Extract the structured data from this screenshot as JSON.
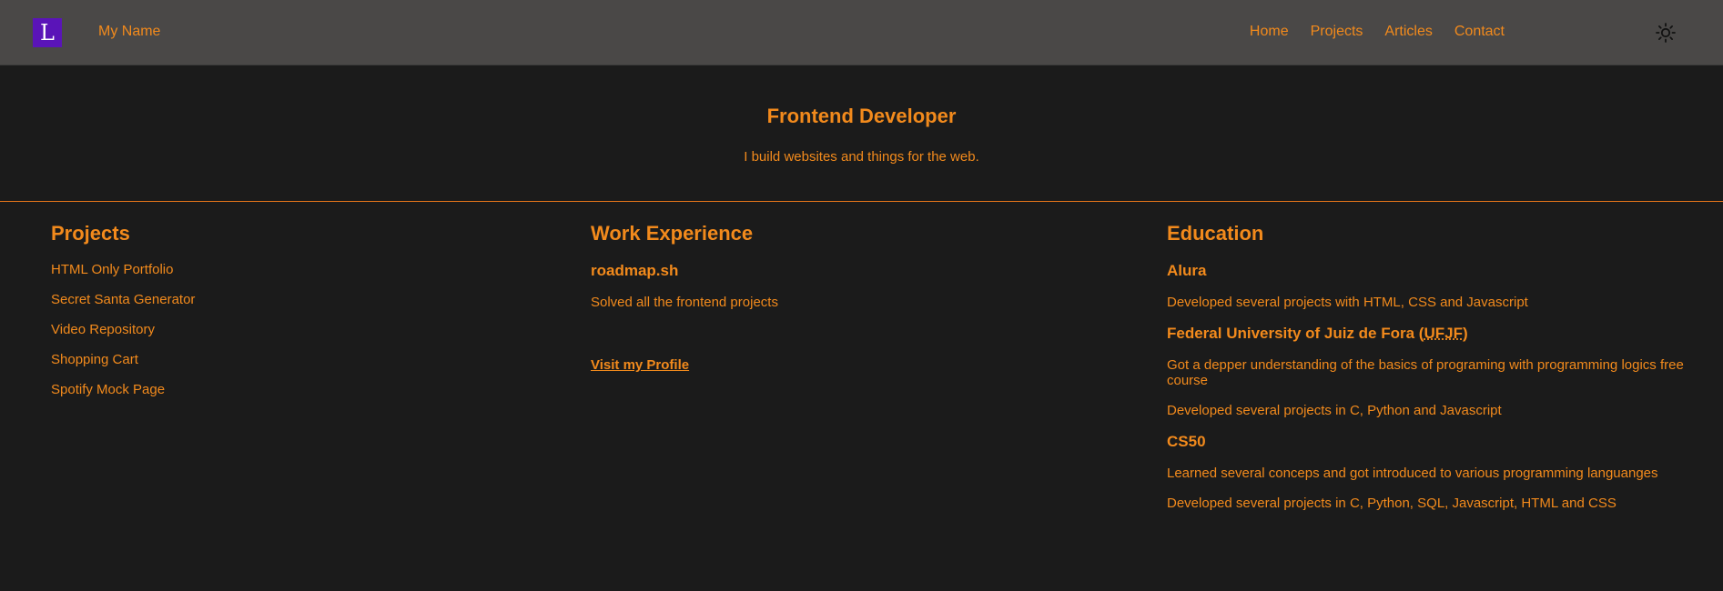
{
  "header": {
    "logo_letter": "L",
    "brand_name": "My Name",
    "nav": [
      {
        "label": "Home"
      },
      {
        "label": "Projects"
      },
      {
        "label": "Articles"
      },
      {
        "label": "Contact"
      }
    ],
    "theme_icon": "sun-icon"
  },
  "hero": {
    "title": "Frontend Developer",
    "subtitle": "I build websites and things for the web."
  },
  "projects": {
    "heading": "Projects",
    "items": [
      "HTML Only Portfolio",
      "Secret Santa Generator",
      "Video Repository",
      "Shopping Cart",
      "Spotify Mock Page"
    ]
  },
  "work": {
    "heading": "Work Experience",
    "company": "roadmap.sh",
    "description": "Solved all the frontend projects",
    "profile_link": "Visit my Profile"
  },
  "education": {
    "heading": "Education",
    "alura": {
      "title": "Alura",
      "items": [
        "Developed several projects with HTML, CSS and Javascript"
      ]
    },
    "ufjf": {
      "title_prefix": "Federal University of Juiz de Fora (",
      "abbr": "UFJF",
      "title_suffix": ")",
      "items": [
        "Got a depper understanding of the basics of programing with programming logics free course",
        "Developed several projects in C, Python and Javascript"
      ]
    },
    "cs50": {
      "title": "CS50",
      "items": [
        "Learned several conceps and got introduced to various programming languanges",
        "Developed several projects in C, Python, SQL, Javascript, HTML and CSS"
      ]
    }
  },
  "colors": {
    "background": "#1b1b1b",
    "header_bg": "#4a4847",
    "accent": "#f28a1c",
    "logo_bg": "#5a14b8"
  }
}
